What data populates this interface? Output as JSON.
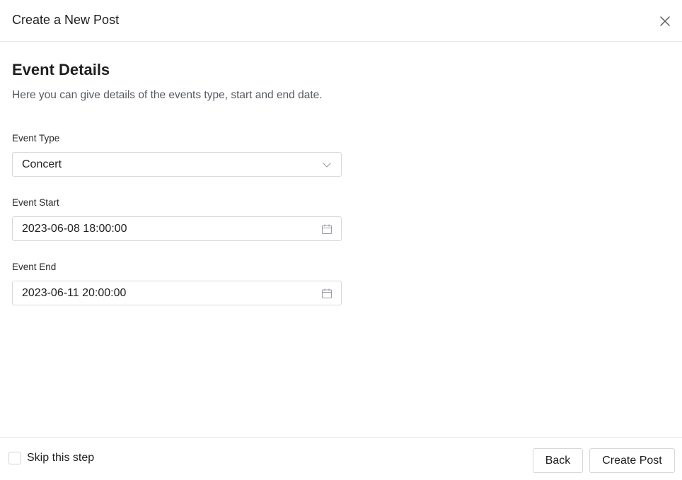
{
  "modal": {
    "title": "Create a New Post",
    "close_icon": "close-icon"
  },
  "section": {
    "title": "Event Details",
    "description": "Here you can give details of the events type, start and end date."
  },
  "fields": {
    "event_type": {
      "label": "Event Type",
      "value": "Concert",
      "icon": "chevron-down-icon"
    },
    "event_start": {
      "label": "Event Start",
      "value": "2023-06-08 18:00:00",
      "icon": "calendar-icon"
    },
    "event_end": {
      "label": "Event End",
      "value": "2023-06-11 20:00:00",
      "icon": "calendar-icon"
    }
  },
  "footer": {
    "skip_label": "Skip this step",
    "skip_checked": false,
    "back_label": "Back",
    "create_label": "Create Post"
  }
}
